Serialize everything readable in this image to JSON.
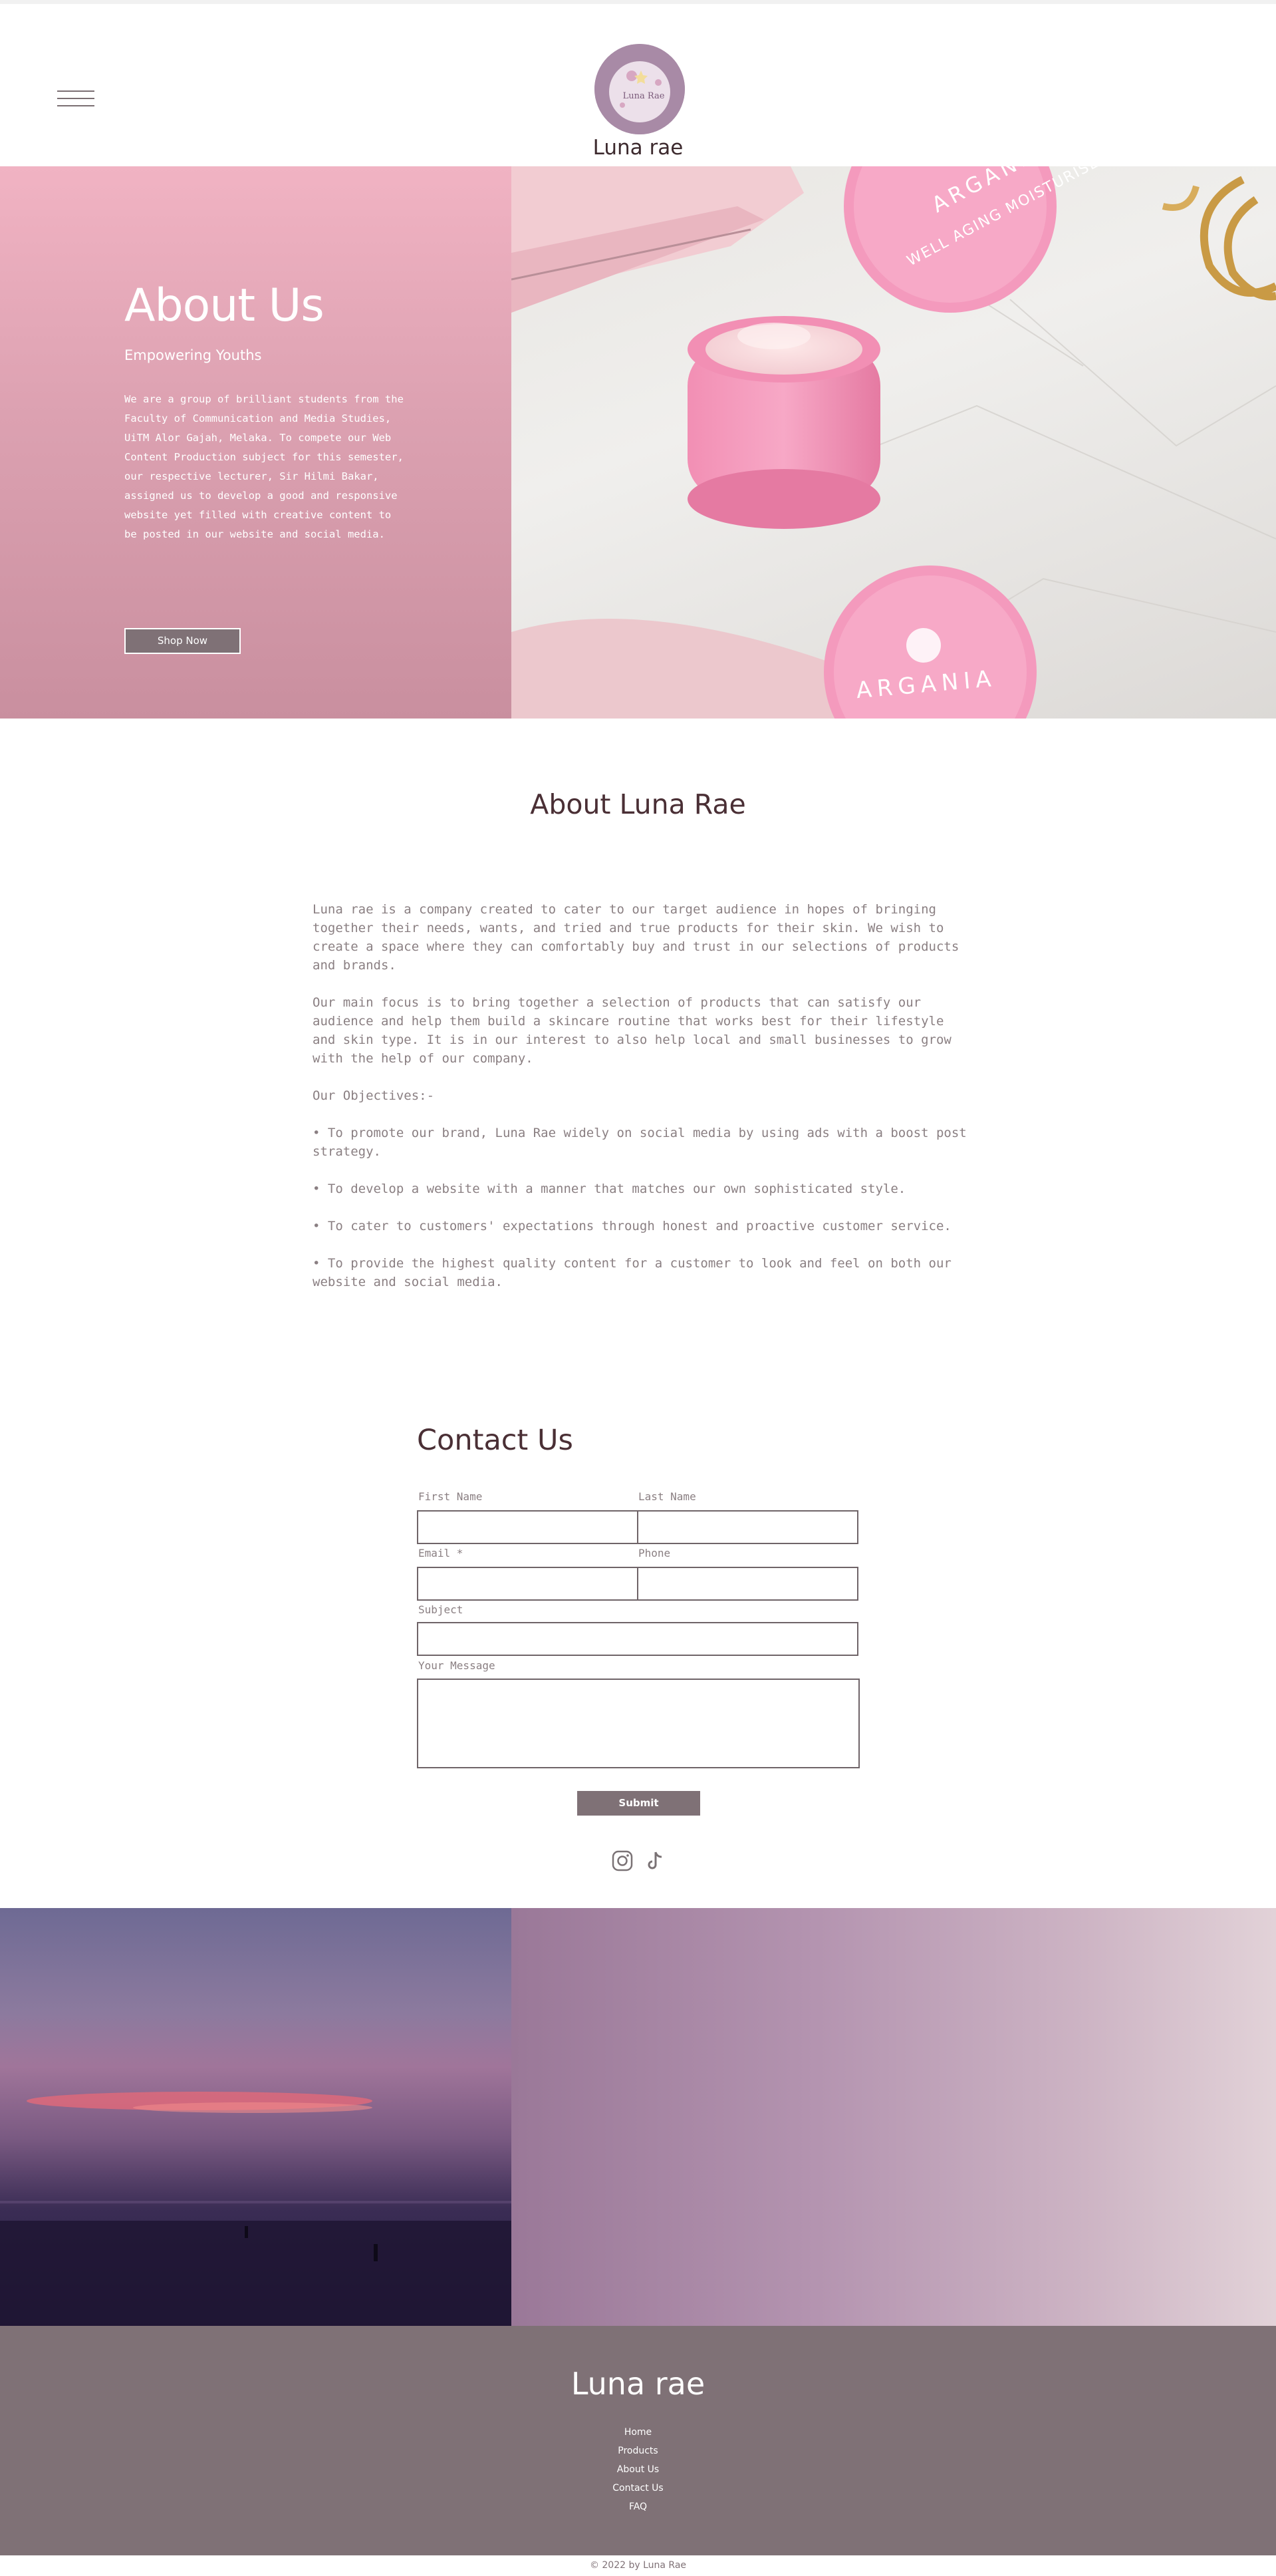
{
  "header": {
    "site_title": "Luna rae",
    "logo_text": "Luna Rae"
  },
  "hero": {
    "title": "About Us",
    "subtitle": "Empowering Youths",
    "body": "We are a group of brilliant students from the Faculty of Communication and Media Studies, UiTM Alor Gajah, Melaka. To compete our Web Content Production subject for this semester, our respective lecturer, Sir Hilmi Bakar, assigned us to develop a good and responsive website yet filled with creative content to be posted in our website and social media.",
    "button_label": "Shop Now",
    "product_lid_text_1": "ARGANIA",
    "product_lid_text_2": "WELL AGING MOISTURISER"
  },
  "about": {
    "title": "About Luna Rae",
    "paragraphs": [
      "Luna rae is a company created to cater to our target audience in hopes of bringing together their needs, wants, and tried and true products for their skin. We wish to create a space where they can comfortably buy and trust in our selections of products and brands.",
      "Our main focus is to bring together a selection of products that can satisfy our audience and help them build a skincare routine that works best for their lifestyle and skin type. It is in our interest to also help local and small businesses to grow with the help of our company.",
      "Our Objectives:-",
      "• To promote our brand, Luna Rae widely on social media by using ads with a boost post strategy.",
      "• To develop a website with a manner that matches our own sophisticated style.",
      "• To cater to customers' expectations through honest and proactive customer service.",
      "• To provide the highest quality content for a customer to look and feel on both our website and social media."
    ]
  },
  "contact": {
    "title": "Contact Us",
    "first_name_label": "First Name",
    "last_name_label": "Last Name",
    "email_label": "Email *",
    "phone_label": "Phone",
    "subject_label": "Subject",
    "message_label": "Your Message",
    "submit_label": "Submit"
  },
  "social": {
    "icons": [
      "instagram-icon",
      "tiktok-icon"
    ]
  },
  "footer": {
    "title": "Luna rae",
    "nav": [
      "Home",
      "Products",
      "About Us",
      "Contact Us",
      "FAQ"
    ],
    "copyright": "© 2022 by Luna Rae"
  },
  "colors": {
    "brand_dark": "#4a2f35",
    "accent_gray": "#7f7176",
    "hero_pink": "#e8a9b9",
    "logo_purple": "#a88aa6"
  }
}
